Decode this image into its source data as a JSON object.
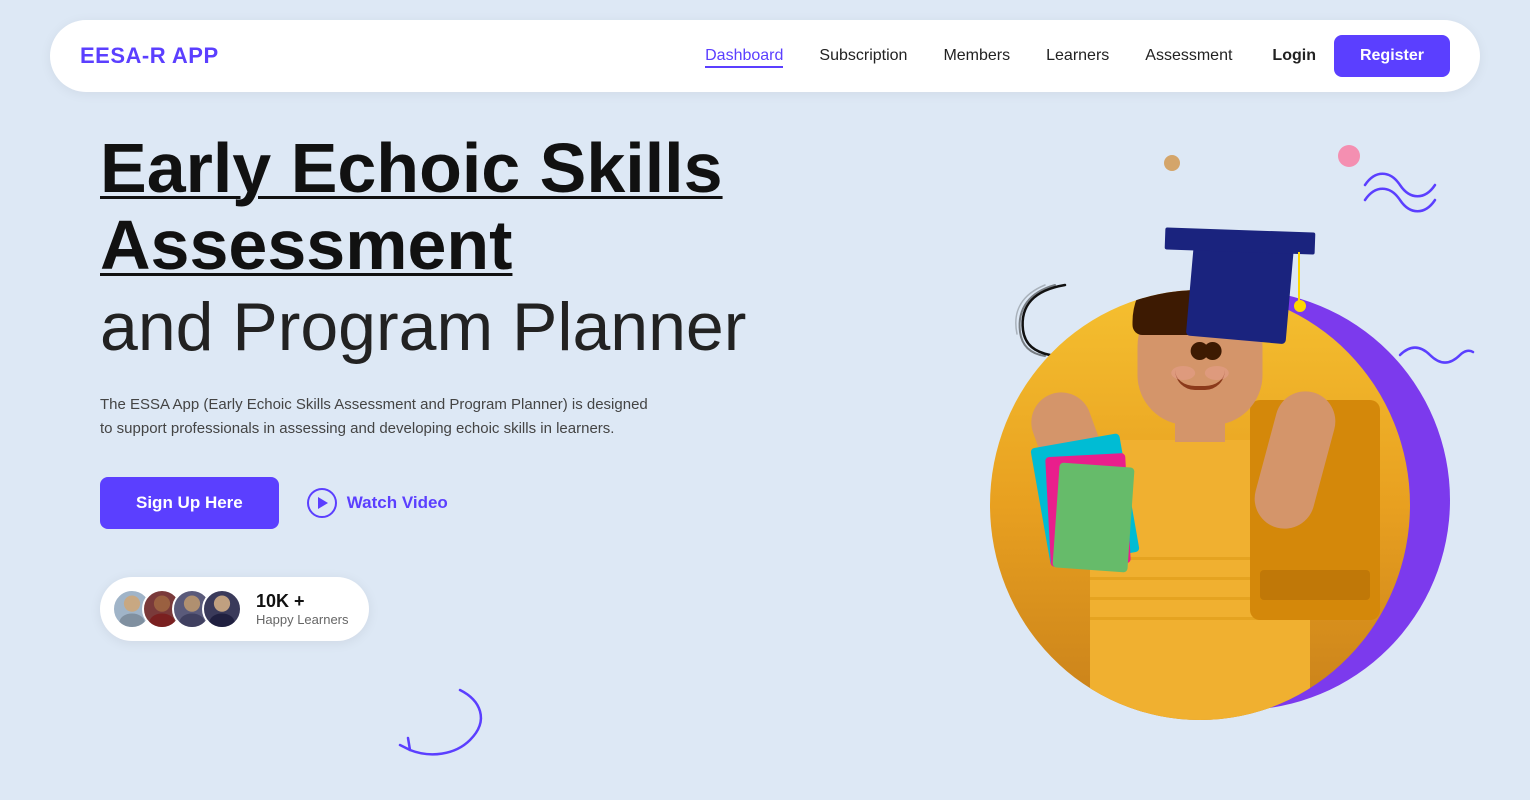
{
  "app": {
    "logo": "EESA-R APP"
  },
  "nav": {
    "links": [
      {
        "label": "Dashboard",
        "active": true
      },
      {
        "label": "Subscription",
        "active": false
      },
      {
        "label": "Members",
        "active": false
      },
      {
        "label": "Learners",
        "active": false
      },
      {
        "label": "Assessment",
        "active": false
      }
    ],
    "login_label": "Login",
    "register_label": "Register"
  },
  "hero": {
    "title_line1": "Early Echoic Skills",
    "title_line2": "Assessment",
    "title_line3": "and Program Planner",
    "description": "The ESSA App (Early Echoic Skills Assessment and Program Planner) is designed to support professionals in assessing and developing echoic skills in learners.",
    "signup_label": "Sign Up Here",
    "watch_label": "Watch Video"
  },
  "badge": {
    "count": "10K +",
    "label": "Happy Learners"
  },
  "colors": {
    "primary": "#5b3fff",
    "background": "#dde8f5",
    "white": "#ffffff",
    "text_dark": "#111111",
    "text_mid": "#444444"
  }
}
